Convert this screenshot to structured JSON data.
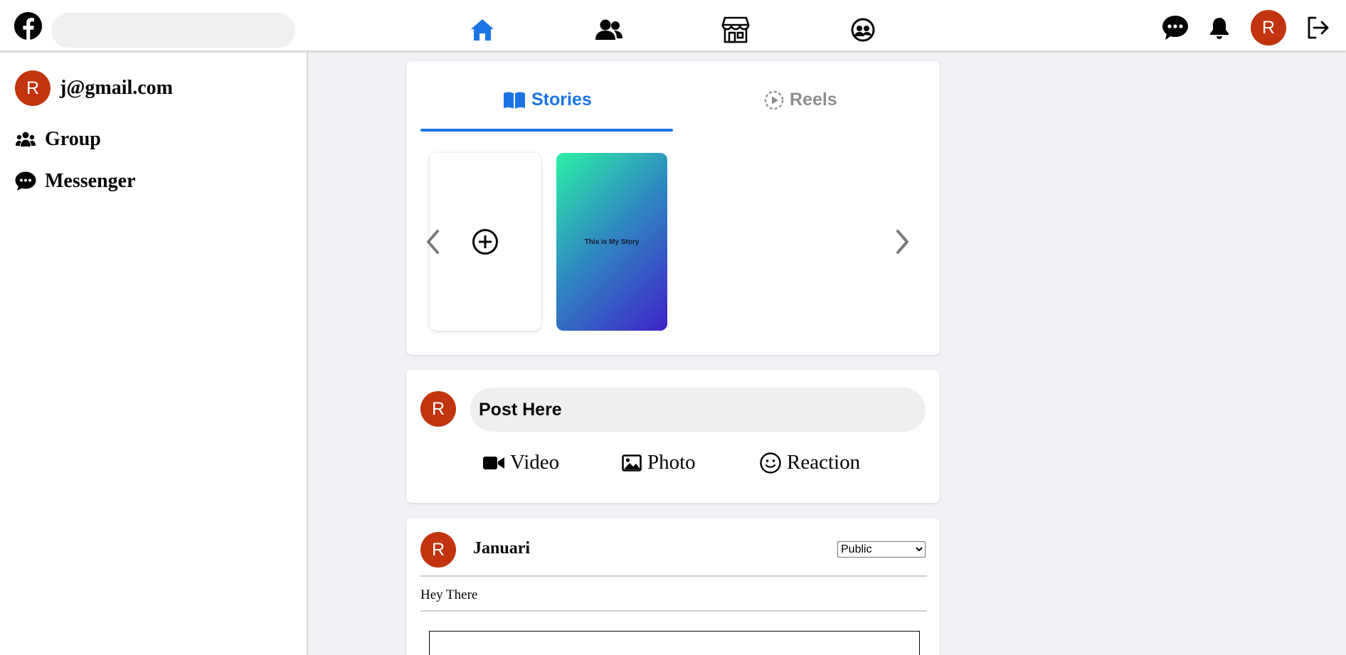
{
  "app": {
    "brand_color": "#1b74e4",
    "avatar_color": "#c1340f"
  },
  "header": {
    "search": {
      "placeholder": "",
      "value": ""
    },
    "nav": [
      {
        "name": "home",
        "icon": "home-icon",
        "active": true
      },
      {
        "name": "friends",
        "icon": "friends-icon"
      },
      {
        "name": "marketplace",
        "icon": "marketplace-icon"
      },
      {
        "name": "groups",
        "icon": "groups-icon"
      }
    ],
    "avatar_initial": "R"
  },
  "sidebar": {
    "user": {
      "avatar_initial": "R",
      "label": "j@gmail.com"
    },
    "items": [
      {
        "label": "Group",
        "icon": "group-icon"
      },
      {
        "label": "Messenger",
        "icon": "messenger-icon"
      }
    ]
  },
  "stories_card": {
    "tabs": [
      {
        "label": "Stories",
        "icon": "book-open-icon",
        "active": true
      },
      {
        "label": "Reels",
        "icon": "reels-icon",
        "active": false
      }
    ],
    "my_story_text": "This is My Story"
  },
  "composer": {
    "avatar_initial": "R",
    "placeholder": "Post Here",
    "actions": [
      {
        "label": "Video",
        "icon": "video-icon"
      },
      {
        "label": "Photo",
        "icon": "photo-icon"
      },
      {
        "label": "Reaction",
        "icon": "smile-icon"
      }
    ]
  },
  "post": {
    "avatar_initial": "R",
    "author": "Januari",
    "privacy": {
      "selected": "Public"
    },
    "text": "Hey There"
  }
}
